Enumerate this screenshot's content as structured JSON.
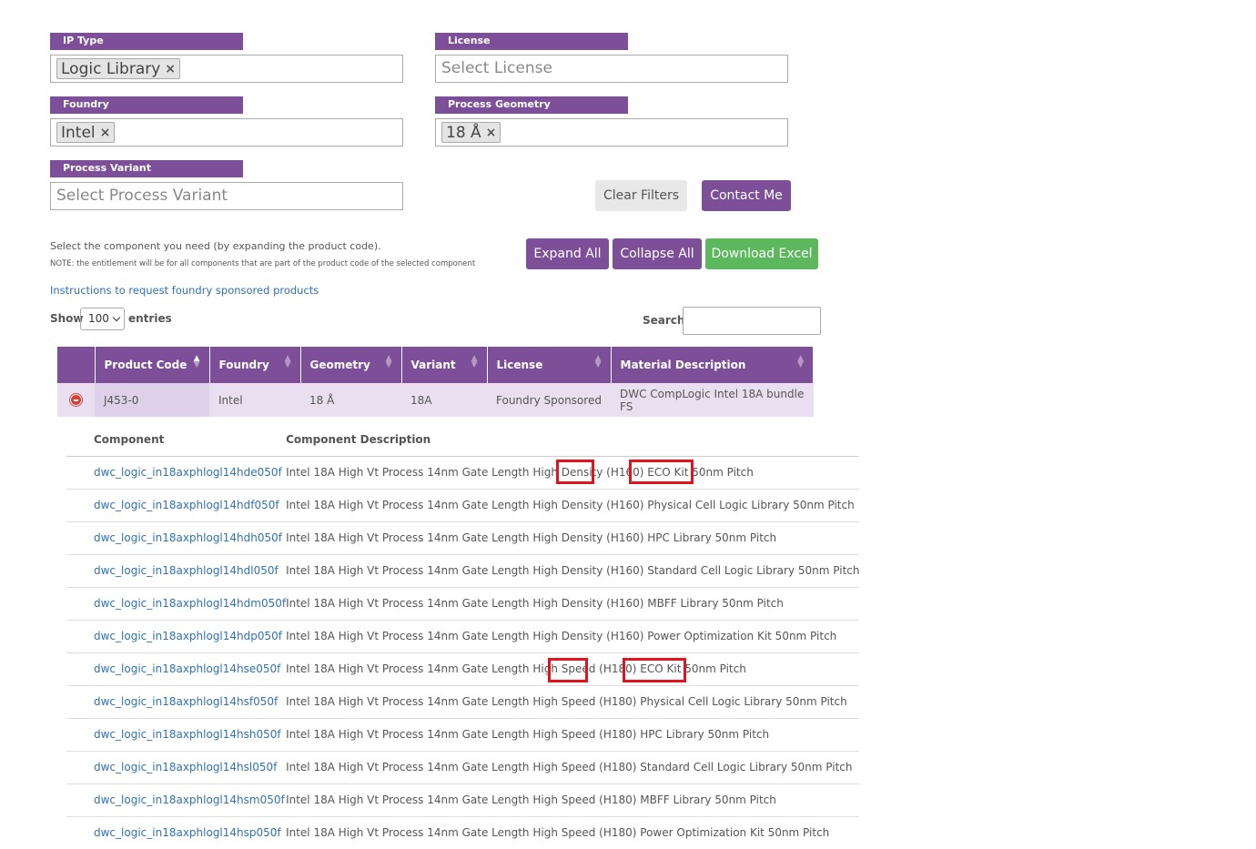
{
  "filters": {
    "ip_type": {
      "label": "IP Type",
      "tag": "Logic Library"
    },
    "license": {
      "label": "License",
      "placeholder": "Select License"
    },
    "foundry": {
      "label": "Foundry",
      "tag": "Intel"
    },
    "process_geometry": {
      "label": "Process Geometry",
      "tag": "18 Å"
    },
    "process_variant": {
      "label": "Process Variant",
      "placeholder": "Select Process Variant"
    },
    "remove_glyph": "×"
  },
  "buttons": {
    "clear_filters": "Clear Filters",
    "contact_me": "Contact Me",
    "expand_all": "Expand All",
    "collapse_all": "Collapse All",
    "download_excel": "Download Excel"
  },
  "info": {
    "select_text": "Select the component you need (by expanding the product code).",
    "note_text": "NOTE: the entitlement will be for all components that are part of the product code of the selected component",
    "instructions_link": "Instructions to request foundry sponsored products"
  },
  "table_controls": {
    "show_label": "Show",
    "entries_value": "100",
    "entries_label": "entries",
    "search_label": "Search:",
    "search_value": ""
  },
  "main_table": {
    "headers": [
      "Product Code",
      "Foundry",
      "Geometry",
      "Variant",
      "License",
      "Material Description"
    ],
    "row": {
      "product_code": "J453-0",
      "foundry": "Intel",
      "geometry": "18 Å",
      "variant": "18A",
      "license": "Foundry Sponsored",
      "material_description": "DWC CompLogic Intel 18A bundle FS"
    }
  },
  "sub_table": {
    "headers": [
      "Component",
      "Component Description"
    ],
    "rows": [
      {
        "component": "dwc_logic_in18axphlogl14hde050f",
        "description": "Intel 18A High Vt Process 14nm Gate Length High Density (H160) ECO Kit 50nm Pitch"
      },
      {
        "component": "dwc_logic_in18axphlogl14hdf050f",
        "description": "Intel 18A High Vt Process 14nm Gate Length High Density (H160) Physical Cell Logic Library 50nm Pitch"
      },
      {
        "component": "dwc_logic_in18axphlogl14hdh050f",
        "description": "Intel 18A High Vt Process 14nm Gate Length High Density (H160) HPC Library 50nm Pitch"
      },
      {
        "component": "dwc_logic_in18axphlogl14hdl050f",
        "description": "Intel 18A High Vt Process 14nm Gate Length High Density (H160) Standard Cell Logic Library 50nm Pitch"
      },
      {
        "component": "dwc_logic_in18axphlogl14hdm050f",
        "description": "Intel 18A High Vt Process 14nm Gate Length High Density (H160) MBFF Library 50nm Pitch"
      },
      {
        "component": "dwc_logic_in18axphlogl14hdp050f",
        "description": "Intel 18A High Vt Process 14nm Gate Length High Density (H160) Power Optimization Kit 50nm Pitch"
      },
      {
        "component": "dwc_logic_in18axphlogl14hse050f",
        "description": "Intel 18A High Vt Process 14nm Gate Length High Speed (H180) ECO Kit 50nm Pitch"
      },
      {
        "component": "dwc_logic_in18axphlogl14hsf050f",
        "description": "Intel 18A High Vt Process 14nm Gate Length High Speed (H180) Physical Cell Logic Library 50nm Pitch"
      },
      {
        "component": "dwc_logic_in18axphlogl14hsh050f",
        "description": "Intel 18A High Vt Process 14nm Gate Length High Speed (H180) HPC Library 50nm Pitch"
      },
      {
        "component": "dwc_logic_in18axphlogl14hsl050f",
        "description": "Intel 18A High Vt Process 14nm Gate Length High Speed (H180) Standard Cell Logic Library 50nm Pitch"
      },
      {
        "component": "dwc_logic_in18axphlogl14hsm050f",
        "description": "Intel 18A High Vt Process 14nm Gate Length High Speed (H180) MBFF Library 50nm Pitch"
      },
      {
        "component": "dwc_logic_in18axphlogl14hsp050f",
        "description": "Intel 18A High Vt Process 14nm Gate Length High Speed (H180) Power Optimization Kit 50nm Pitch"
      }
    ]
  },
  "colors": {
    "accent_purple": "#7e4f99",
    "row_highlight": "#e9dff0",
    "download_green": "#5cb85c",
    "annotation_red": "#e0141e",
    "link_blue": "#2f72b5"
  }
}
